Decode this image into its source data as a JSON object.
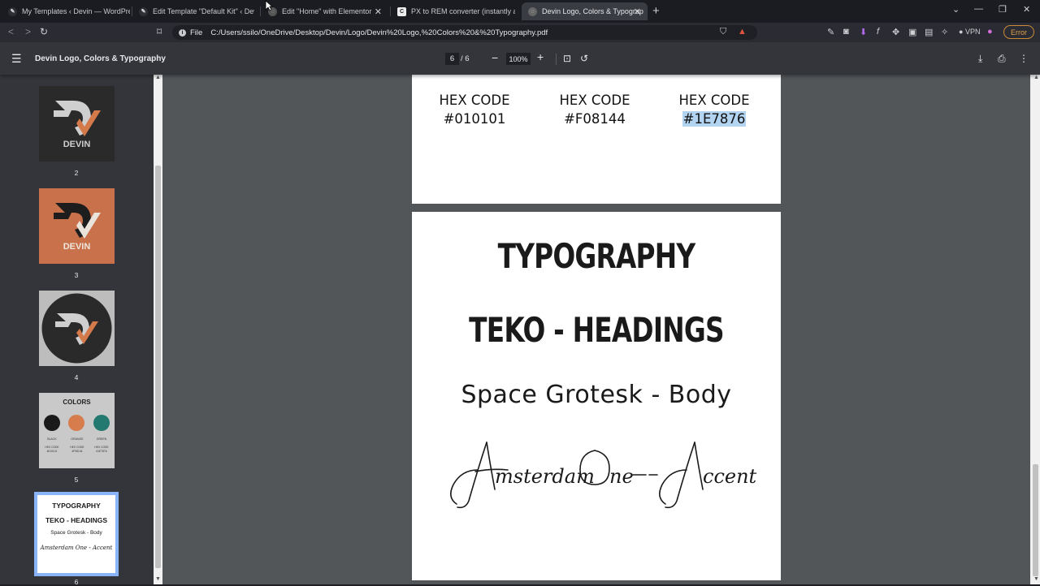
{
  "browser": {
    "tabs": [
      {
        "title": "My Templates ‹ Devin — WordPress",
        "active": false
      },
      {
        "title": "Edit Template \"Default Kit\" ‹ Devin -",
        "active": false
      },
      {
        "title": "Edit \"Home\" with Elementor",
        "active": false
      },
      {
        "title": "PX to REM converter (instantly and",
        "active": false
      },
      {
        "title": "Devin Logo, Colors & Typograp",
        "active": true
      }
    ],
    "address": {
      "scheme_label": "File",
      "url": "C:/Users/ssilo/OneDrive/Desktop/Devin/Logo/Devin%20Logo,%20Colors%20&%20Typography.pdf"
    },
    "vpn_label": "VPN",
    "error_label": "Error"
  },
  "pdf_toolbar": {
    "title": "Devin Logo, Colors & Typography",
    "current_page": "6",
    "total_pages": "/ 6",
    "zoom": "100%"
  },
  "thumbnails": [
    {
      "number": "2",
      "label": "DEVIN"
    },
    {
      "number": "3",
      "label": "DEVIN"
    },
    {
      "number": "4",
      "label": ""
    },
    {
      "number": "5",
      "label": "COLORS",
      "swatches": [
        "BLACK",
        "ORANGE",
        "GREEN"
      ],
      "codes": [
        "HEX CODE #010101",
        "HEX CODE #F08144",
        "HEX CODE #1E7876"
      ]
    },
    {
      "number": "6",
      "label": "TYPOGRAPHY",
      "lines": [
        "TEKO - HEADINGS",
        "Space Grotesk - Body",
        "Amsterdam One - Accent"
      ]
    }
  ],
  "colors": {
    "black": "#010101",
    "orange": "#F08144",
    "green": "#1E7876",
    "accent_highlight": "#b3d4f1"
  },
  "page5": {
    "hex_label": "HEX CODE",
    "codes": [
      "#010101",
      "#F08144",
      "#1E7876"
    ]
  },
  "page6": {
    "heading": "TYPOGRAPHY",
    "line1": "TEKO - HEADINGS",
    "line2": "Space Grotesk - Body",
    "line3": "Amsterdam One - Accent"
  }
}
